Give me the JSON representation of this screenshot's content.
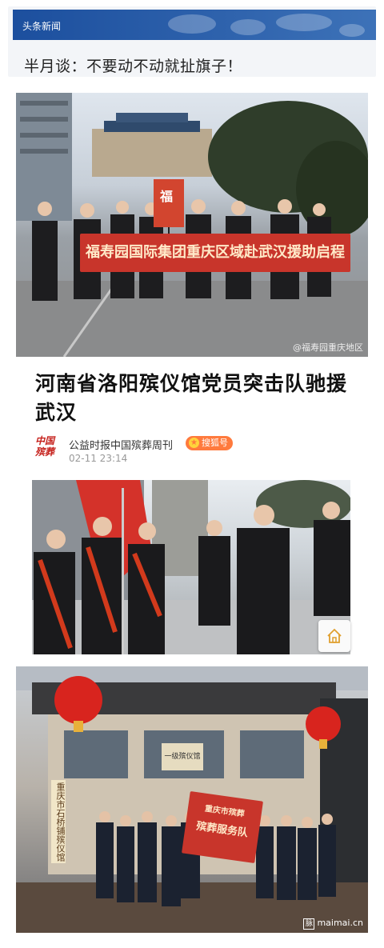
{
  "header": {
    "source_tag": "头条新闻",
    "headline": "半月谈：不要动不动就扯旗子！"
  },
  "photo1": {
    "banner_text": "福寿园国际集团重庆区域赴武汉援助启程",
    "flag_text": "福",
    "watermark": "@福寿园重庆地区"
  },
  "article": {
    "title": "河南省洛阳殡仪馆党员突击队驰援武汉",
    "logo_text": "中国殡葬",
    "author": "公益时报中国殡葬周刊",
    "badge": "搜狐号",
    "time": "02-11 23:14"
  },
  "photo3": {
    "plaque_text": "一级殡仪馆",
    "vertical_sign": "重庆市石桥铺殡仪馆",
    "banner_line1": "重庆市殡葬",
    "banner_line2": "殡葬服务队",
    "watermark": "maimai.cn"
  },
  "colors": {
    "brand_blue": "#1c4f9e",
    "banner_red": "#c8352b",
    "sohu_orange": "#ff7a3d"
  }
}
